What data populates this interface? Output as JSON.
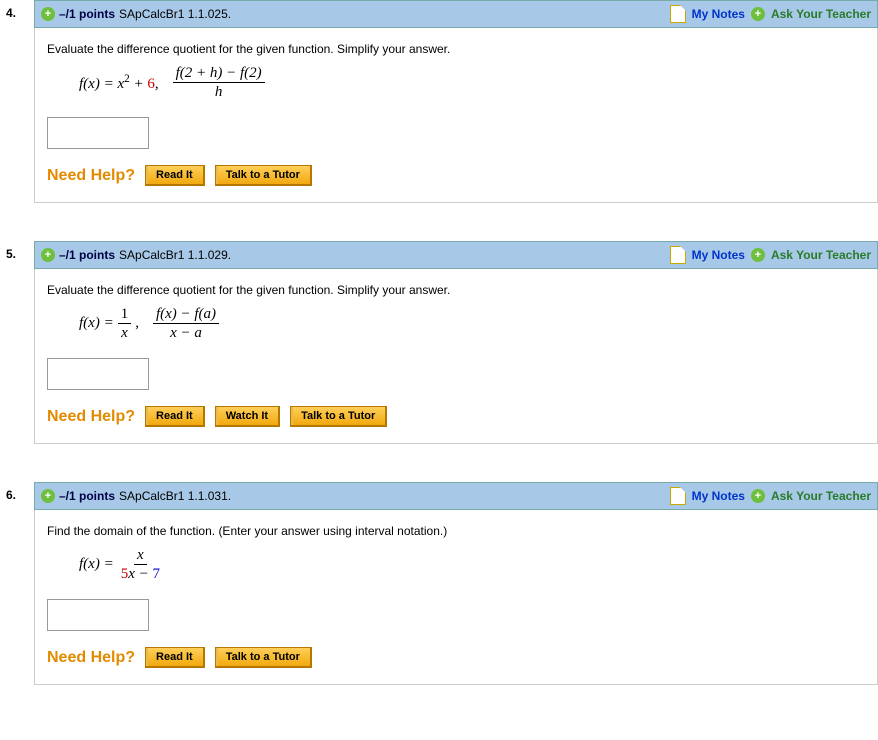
{
  "shared": {
    "need_help_label": "Need Help?",
    "my_notes_label": "My Notes",
    "ask_teacher_label": "Ask Your Teacher",
    "points_label": "–/1 points"
  },
  "buttons": {
    "read_it": "Read It",
    "watch_it": "Watch It",
    "talk_tutor": "Talk to a Tutor"
  },
  "questions": [
    {
      "number": "4.",
      "ref": "SApCalcBr1 1.1.025.",
      "prompt": "Evaluate the difference quotient for the given function. Simplify your answer.",
      "math": {
        "func_lhs": "f(x) = x",
        "func_sup": "2",
        "func_tail": " + ",
        "const": "6",
        "quot_num": "f(2 + h) − f(2)",
        "quot_den": "h"
      },
      "help_buttons": [
        "read_it",
        "talk_tutor"
      ]
    },
    {
      "number": "5.",
      "ref": "SApCalcBr1 1.1.029.",
      "prompt": "Evaluate the difference quotient for the given function. Simplify your answer.",
      "math": {
        "func_lhs": "f(x) = ",
        "frac1_num": "1",
        "frac1_den": "x",
        "quot_num": "f(x) − f(a)",
        "quot_den": "x − a"
      },
      "help_buttons": [
        "read_it",
        "watch_it",
        "talk_tutor"
      ]
    },
    {
      "number": "6.",
      "ref": "SApCalcBr1 1.1.031.",
      "prompt": "Find the domain of the function. (Enter your answer using interval notation.)",
      "math": {
        "func_lhs": "f(x) = ",
        "frac1_num": "x",
        "frac1_den_a": "5",
        "frac1_den_b": "x − ",
        "frac1_den_c": "7"
      },
      "help_buttons": [
        "read_it",
        "talk_tutor"
      ]
    }
  ]
}
